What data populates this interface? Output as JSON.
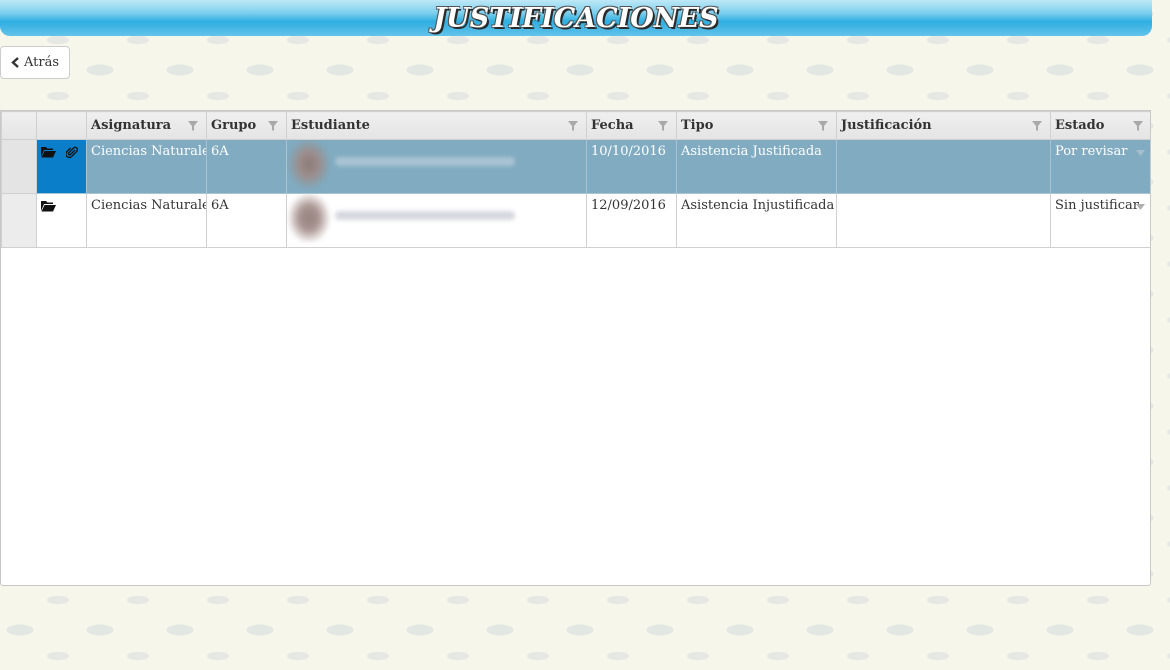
{
  "header": {
    "title": "JUSTIFICACIONES"
  },
  "back_button": {
    "label": "Atrás",
    "icon": "chevron-left-icon"
  },
  "table": {
    "columns": [
      "Asignatura",
      "Grupo",
      "Estudiante",
      "Fecha",
      "Tipo",
      "Justificación",
      "Estado"
    ],
    "rows": [
      {
        "selected": true,
        "icons": [
          "folder-open-icon",
          "paperclip-icon"
        ],
        "asignatura": "Ciencias Naturales",
        "grupo": "6A",
        "fecha": "10/10/2016",
        "tipo": "Asistencia Justificada",
        "justificacion": "",
        "estado": "Por revisar"
      },
      {
        "selected": false,
        "icons": [
          "folder-open-icon"
        ],
        "asignatura": "Ciencias Naturales",
        "grupo": "6A",
        "fecha": "12/09/2016",
        "tipo": "Asistencia Injustificada",
        "justificacion": "",
        "estado": "Sin justificar"
      }
    ]
  },
  "colors": {
    "banner": "#2eaee0",
    "selected_row": "#80abc0",
    "selected_actions": "#0a7ec9"
  }
}
